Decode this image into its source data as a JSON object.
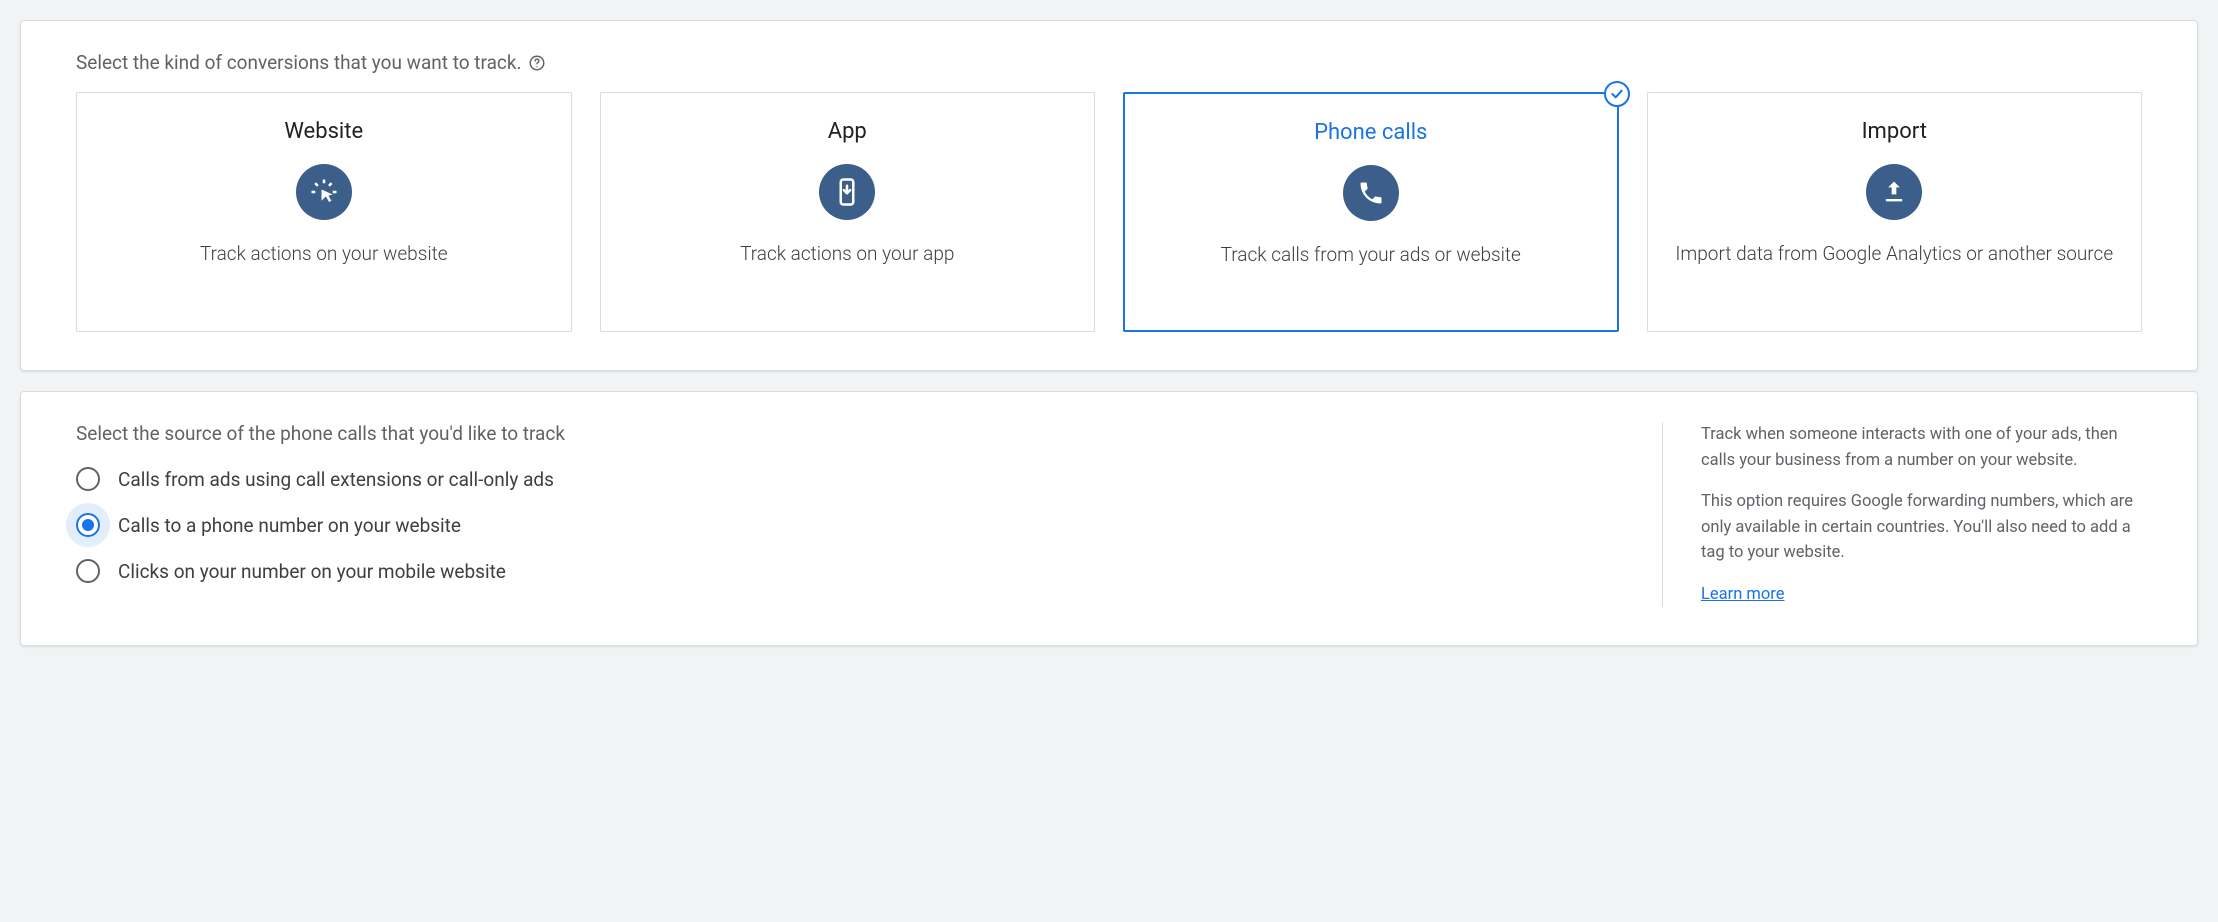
{
  "conversion_kind": {
    "heading": "Select the kind of conversions that you want to track.",
    "selected_index": 2,
    "tiles": [
      {
        "title": "Website",
        "icon": "click-icon",
        "desc": "Track actions on your website"
      },
      {
        "title": "App",
        "icon": "app-icon",
        "desc": "Track actions on your app"
      },
      {
        "title": "Phone calls",
        "icon": "phone-icon",
        "desc": "Track calls from your ads or website"
      },
      {
        "title": "Import",
        "icon": "upload-icon",
        "desc": "Import data from Google Analytics or another source"
      }
    ]
  },
  "phone_source": {
    "heading": "Select the source of the phone calls that you'd like to track",
    "selected_index": 1,
    "options": [
      "Calls from ads using call extensions or call-only ads",
      "Calls to a phone number on your website",
      "Clicks on your number on your mobile website"
    ],
    "info": {
      "p1": "Track when someone interacts with one of your ads, then calls your business from a number on your website.",
      "p2": "This option requires Google forwarding numbers, which are only available in certain countries. You'll also need to add a tag to your website.",
      "learn_more": "Learn more"
    }
  }
}
